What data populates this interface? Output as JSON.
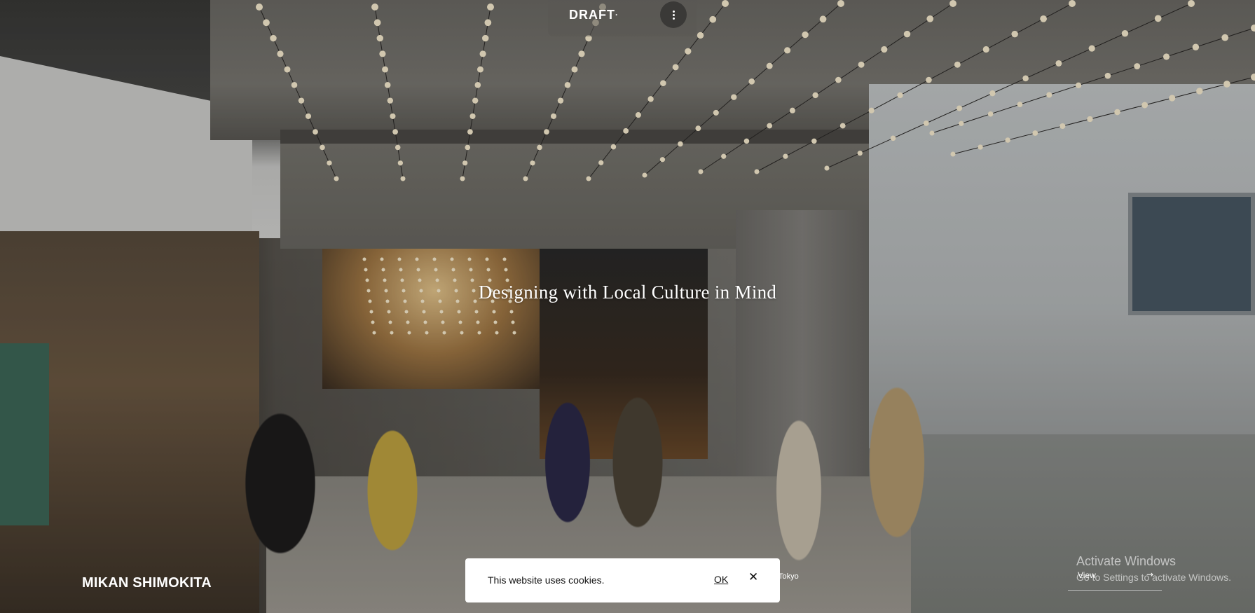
{
  "header": {
    "brand": "DRAFT",
    "brand_mark": ".",
    "menu_icon": "kebab-menu-icon"
  },
  "hero": {
    "headline": "Designing with Local Culture in Mind",
    "project_title": "MIKAN SHIMOKITA",
    "location": "Tokyo",
    "view_label": "View",
    "view_icon": "arrow-right-icon"
  },
  "cookie_banner": {
    "message": "This website uses cookies.",
    "ok_label": "OK",
    "close_icon": "close-icon",
    "close_glyph": "✕"
  },
  "os_watermark": {
    "title": "Activate Windows",
    "subtitle": "Go to Settings to activate Windows."
  },
  "colors": {
    "banner_bg": "#ffffff",
    "text_light": "#ffffff",
    "text_dark": "#111111"
  }
}
